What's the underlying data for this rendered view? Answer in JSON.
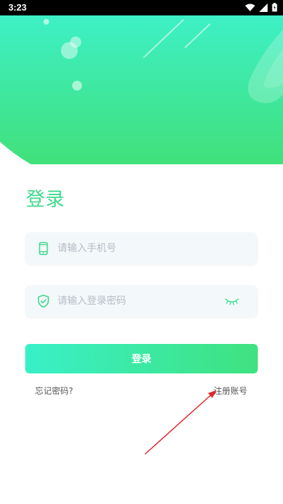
{
  "status_bar": {
    "time": "3:23",
    "icons": [
      "wifi-icon",
      "signal-icon",
      "battery-icon"
    ]
  },
  "colors": {
    "accent": "#3ed98c",
    "button_gradient_start": "#39f0c8",
    "button_gradient_end": "#3fe27f",
    "annotation_arrow": "#e0262b"
  },
  "login": {
    "title": "登录",
    "phone": {
      "icon": "phone-icon",
      "placeholder": "请输入手机号",
      "value": ""
    },
    "password": {
      "icon": "shield-check-icon",
      "placeholder": "请输入登录密码",
      "value": "",
      "toggle_icon": "eye-closed-icon"
    },
    "submit_label": "登录",
    "forgot_password": "忘记密码?",
    "register": "注册账号"
  }
}
